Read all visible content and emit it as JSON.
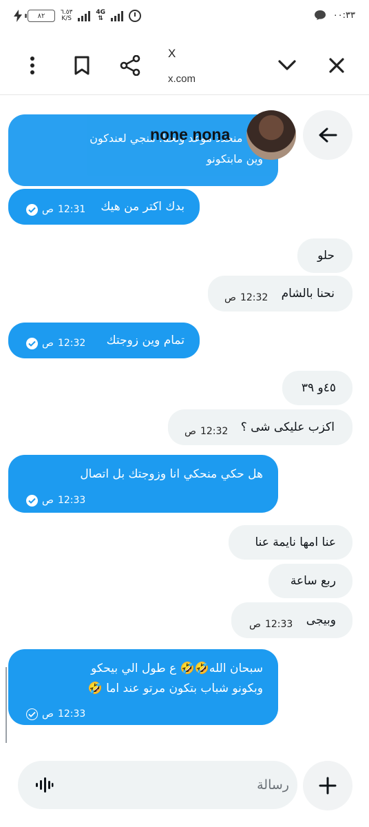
{
  "status_bar": {
    "time": "٠٠:٣٣",
    "battery": "٨٢",
    "net_speed": "٦.٥٣",
    "net_unit": "K/S",
    "network_type": "4G"
  },
  "browser": {
    "title": "X",
    "url": "x.com"
  },
  "chat_header": {
    "name": "none nona"
  },
  "messages": [
    {
      "dir": "out",
      "text": "نحنا منحدد موعد ونحنا. منجي لعندكون\nوين مابتكونو",
      "time": ""
    },
    {
      "dir": "out",
      "text": "بدك اكتر من هيك",
      "time": "12:31",
      "period": "ص"
    },
    {
      "dir": "in",
      "text": "حلو",
      "time": ""
    },
    {
      "dir": "in",
      "text": "نحنا بالشام",
      "time": "12:32",
      "period": "ص"
    },
    {
      "dir": "out",
      "text": "تمام وين زوجتك",
      "time": "12:32",
      "period": "ص"
    },
    {
      "dir": "in",
      "text": "٤٥و ٣٩",
      "time": ""
    },
    {
      "dir": "in",
      "text": "اكزب عليكى شى ؟",
      "time": "12:32",
      "period": "ص"
    },
    {
      "dir": "out",
      "text": "هل حكي منحكي انا وزوجتك بل اتصال",
      "time": "12:33",
      "period": "ص"
    },
    {
      "dir": "in",
      "text": "عنا امها نايمة عنا",
      "time": ""
    },
    {
      "dir": "in",
      "text": "ربع ساعة",
      "time": ""
    },
    {
      "dir": "in",
      "text": "وبيجى",
      "time": "12:33",
      "period": "ص"
    },
    {
      "dir": "out",
      "text": "سبحان الله🤣🤣 ع طول الي بيحكو\nوبكونو شباب بتكون مرتو عند اما 🤣",
      "time": "12:33",
      "period": "ص"
    }
  ],
  "composer": {
    "placeholder": "رسالة"
  },
  "colors": {
    "accent": "#1d9bf0",
    "incoming_bubble": "#eff3f4"
  },
  "icons": [
    "more-vert-icon",
    "bookmark-icon",
    "share-icon",
    "chevron-down-icon",
    "close-icon",
    "back-arrow-icon",
    "voice-icon",
    "plus-icon",
    "read-check-icon"
  ]
}
